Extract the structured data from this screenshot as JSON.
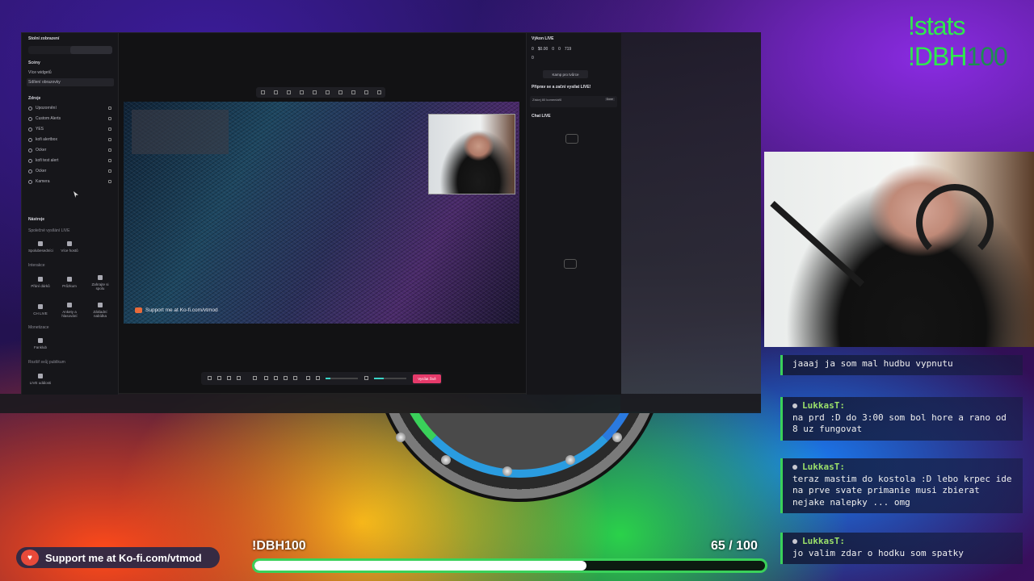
{
  "app": {
    "sidebar": {
      "layout_menu": "Stolní zobrazení",
      "scenes_heading": "Scény",
      "scenes": [
        "Více widgetů",
        "Sdílení obrazovky"
      ],
      "sources_heading": "Zdroje",
      "sources": [
        "Upozornění",
        "Custom Alerts",
        "YES",
        "kofi alertbox",
        "Ocker",
        "kofi test alert",
        "Ocker",
        "Kamera"
      ],
      "tools_heading": "Nástroje",
      "collab_heading": "Společné vysílání LIVE",
      "collab_tiles": [
        "Spolubesedníci",
        "Více hostů"
      ],
      "interaction_heading": "Interakce",
      "interaction_tiles": [
        "Přání dárků",
        "Průzkum",
        "Zahrajte si spolu",
        "CH LIVE",
        "Ankety a hlasování",
        "Základní nabídka"
      ],
      "monetization_heading": "Monetizace",
      "monetization_tiles": [
        "Fanklub"
      ],
      "audience_heading": "Rozšiř svůj publikum",
      "audience_tiles": [
        "LIVE události"
      ]
    },
    "canvas": {
      "kofi_text": "Support me at Ko-fi.com/vtmod"
    },
    "controls": {
      "go_live_label": "Vysílat živě"
    },
    "right_panel": {
      "title": "Výkon LIVE",
      "metrics": [
        "0",
        "$0.00",
        "0",
        "0",
        "719"
      ],
      "viewers": "0",
      "host_button": "Kamp pro tvůrce",
      "prep_heading": "Připrav se a začni vysílat LIVE!",
      "task_label": "Získej 80 komentářů",
      "task_status": "Done",
      "chat_heading": "Chat LIVE"
    }
  },
  "overlay": {
    "cmd_stats": "!stats",
    "cmd_dbh_main": "!DBH",
    "cmd_dbh_dim": "100",
    "goal": {
      "label": "!DBH100",
      "current": 65,
      "separator": "/",
      "target": 100,
      "progress": 0.65
    },
    "kofi_banner": "Support me at Ko-fi.com/vtmod",
    "chat": [
      {
        "user": "",
        "text": "jaaaj ja som mal hudbu vypnutu"
      },
      {
        "user": "LukkasT:",
        "text": "na prd :D do 3:00 som bol hore a rano od 8 uz fungovat"
      },
      {
        "user": "LukkasT:",
        "text": "teraz mastim do kostola :D lebo krpec ide na prve svate primanie musi zbierat nejake nalepky ... omg"
      },
      {
        "user": "LukkasT:",
        "text": "jo valim zdar o hodku som spatky"
      }
    ]
  },
  "colors": {
    "accent_green": "#2fe84e",
    "live_button": "#e53a6a",
    "chat_border": "#3ad15a"
  }
}
